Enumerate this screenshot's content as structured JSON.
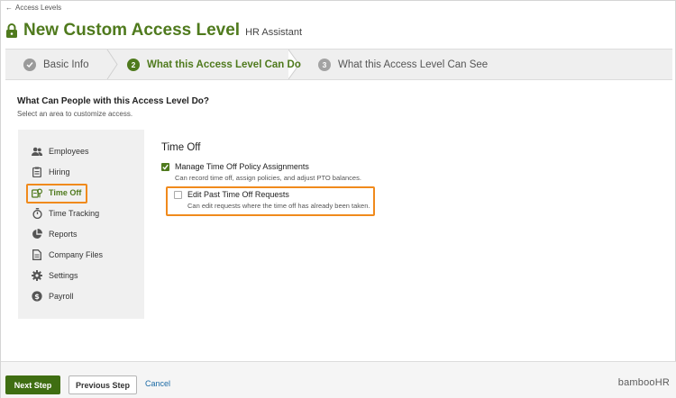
{
  "header": {
    "back_link": "Access Levels",
    "title": "New Custom Access Level",
    "subtitle": "HR Assistant"
  },
  "steps": [
    {
      "number": "",
      "label": "Basic Info",
      "state": "complete"
    },
    {
      "number": "2",
      "label": "What this Access Level Can Do",
      "state": "current"
    },
    {
      "number": "3",
      "label": "What this Access Level Can See",
      "state": "upcoming"
    }
  ],
  "section": {
    "title": "What Can People with this Access Level Do?",
    "subtitle": "Select an area to customize access."
  },
  "sidebar": {
    "items": [
      {
        "label": "Employees",
        "icon": "people-icon"
      },
      {
        "label": "Hiring",
        "icon": "clipboard-icon"
      },
      {
        "label": "Time Off",
        "icon": "time-off-icon",
        "active": true
      },
      {
        "label": "Time Tracking",
        "icon": "stopwatch-icon"
      },
      {
        "label": "Reports",
        "icon": "pie-chart-icon"
      },
      {
        "label": "Company Files",
        "icon": "file-icon"
      },
      {
        "label": "Settings",
        "icon": "gear-icon"
      },
      {
        "label": "Payroll",
        "icon": "dollar-icon"
      }
    ]
  },
  "content": {
    "title": "Time Off",
    "permissions": [
      {
        "label": "Manage Time Off Policy Assignments",
        "description": "Can record time off, assign policies, and adjust PTO balances.",
        "checked": true
      },
      {
        "label": "Edit Past Time Off Requests",
        "description": "Can edit requests where the time off has already been taken.",
        "checked": false
      }
    ]
  },
  "footer": {
    "next_label": "Next Step",
    "previous_label": "Previous Step",
    "cancel_label": "Cancel",
    "brand": "bambooHR"
  },
  "colors": {
    "brand_green": "#4f7a1d",
    "highlight_orange": "#f08a1c",
    "link_blue": "#1b6aa5"
  }
}
